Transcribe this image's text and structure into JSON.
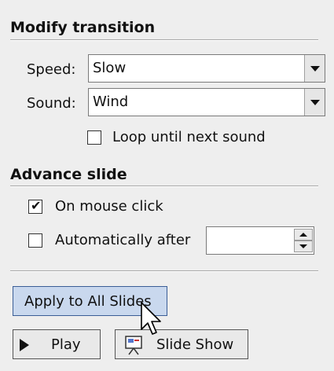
{
  "modify_transition": {
    "title": "Modify transition",
    "speed_label": "Speed:",
    "speed_value": "Slow",
    "sound_label": "Sound:",
    "sound_value": "Wind",
    "loop_label": "Loop until next sound",
    "loop_checked": false
  },
  "advance_slide": {
    "title": "Advance slide",
    "on_mouse_click_label": "On mouse click",
    "on_mouse_click_checked": true,
    "automatically_after_label": "Automatically after",
    "automatically_after_checked": false,
    "automatically_after_value": ""
  },
  "actions": {
    "apply_all_label": "Apply to All Slides",
    "play_label": "Play",
    "slide_show_label": "Slide Show"
  },
  "icons": {
    "dropdown": "chevron-down-icon",
    "spin_up": "spin-up-icon",
    "spin_down": "spin-down-icon",
    "play": "play-icon",
    "slide_show": "slide-show-icon",
    "cursor": "mouse-pointer-icon"
  }
}
